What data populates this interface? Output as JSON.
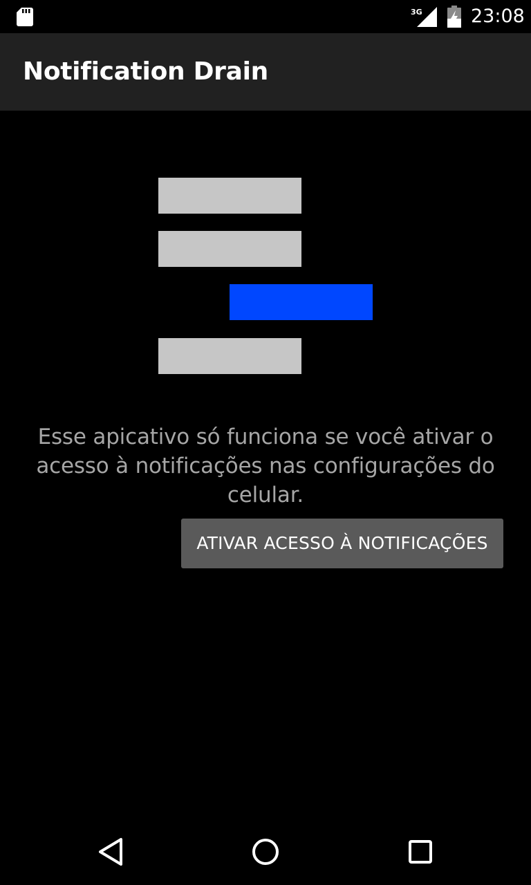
{
  "status_bar": {
    "time": "23:08",
    "network_label": "3G",
    "icons": [
      "sd-card-icon",
      "signal-icon",
      "battery-icon"
    ]
  },
  "app_bar": {
    "title": "Notification Drain"
  },
  "illustration": {
    "bar_colors": {
      "inactive": "#c6c6c6",
      "active": "#0047ff"
    }
  },
  "main": {
    "message": "Esse apicativo só funciona se você ativar o acesso à notificações nas configurações do celular.",
    "button_label": "ATIVAR ACESSO À NOTIFICAÇÕES"
  },
  "nav_bar": {
    "icons": [
      "back-icon",
      "home-icon",
      "recents-icon"
    ]
  },
  "colors": {
    "background": "#000000",
    "app_bar": "#212121",
    "button": "#5a5a5a",
    "message_text": "#a6a6a6"
  }
}
